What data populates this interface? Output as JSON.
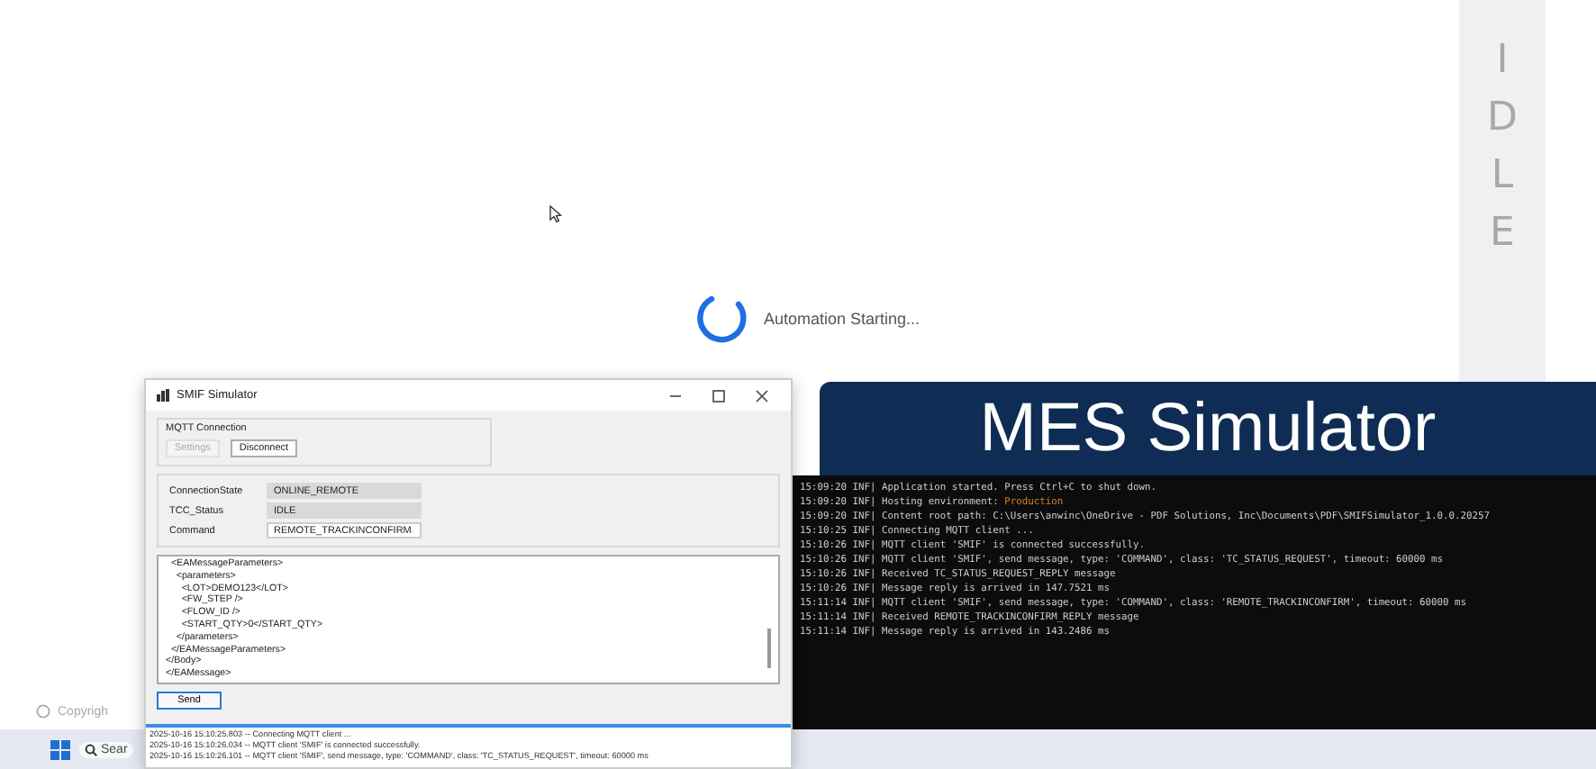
{
  "status_strip": {
    "text": "IDLE"
  },
  "loader": {
    "text": "Automation Starting..."
  },
  "footer": {
    "text": "Copyrigh"
  },
  "taskbar": {
    "search": "Sear"
  },
  "banner": {
    "title": "MES Simulator"
  },
  "console": {
    "lines": [
      {
        "time": "15:09:20",
        "level": "INF|",
        "message": "Application started. Press Ctrl+C to shut down."
      },
      {
        "time": "15:09:20",
        "level": "INF|",
        "message": "Hosting environment: ",
        "value": "Production"
      },
      {
        "time": "15:09:20",
        "level": "INF|",
        "message": "Content root path: C:\\Users\\anwinc\\OneDrive - PDF Solutions, Inc\\Documents\\PDF\\SMIFSimulator_1.0.0.20257"
      },
      {
        "time": "15:10:25",
        "level": "INF|",
        "message": "Connecting MQTT client ..."
      },
      {
        "time": "15:10:26",
        "level": "INF|",
        "message": "MQTT client 'SMIF' is connected successfully."
      },
      {
        "time": "15:10:26",
        "level": "INF|",
        "message": "MQTT client 'SMIF', send message, type: 'COMMAND', class: 'TC_STATUS_REQUEST', timeout: 60000 ms"
      },
      {
        "time": "15:10:26",
        "level": "INF|",
        "message": "Received TC_STATUS_REQUEST_REPLY message"
      },
      {
        "time": "15:10:26",
        "level": "INF|",
        "message": "Message reply is arrived in 147.7521 ms"
      },
      {
        "time": "15:11:14",
        "level": "INF|",
        "message": "MQTT client 'SMIF', send message, type: 'COMMAND', class: 'REMOTE_TRACKINCONFIRM', timeout: 60000 ms"
      },
      {
        "time": "15:11:14",
        "level": "INF|",
        "message": "Received REMOTE_TRACKINCONFIRM_REPLY message"
      },
      {
        "time": "15:11:14",
        "level": "INF|",
        "message": "Message reply is arrived in 143.2486 ms"
      }
    ]
  },
  "smif_window": {
    "title": "SMIF Simulator",
    "group_title": "MQTT Connection",
    "buttons": [
      {
        "label": "Settings",
        "disabled": true
      },
      {
        "label": "Disconnect",
        "disabled": false
      }
    ],
    "fields": [
      {
        "kind": "readonly",
        "label": "ConnectionState",
        "value": "ONLINE_REMOTE"
      },
      {
        "kind": "readonly",
        "label": "TCC_Status",
        "value": "IDLE"
      },
      {
        "kind": "dropdown",
        "label": "Command",
        "value": "REMOTE_TRACKINCONFIRM"
      }
    ],
    "xml_lines": [
      "  <EAMessageParameters>",
      "    <parameters>",
      "      <LOT>DEMO123</LOT>",
      "      <FW_STEP />",
      "      <FLOW_ID />",
      "      <START_QTY>0</START_QTY>",
      "    </parameters>",
      "  </EAMessageParameters>",
      "</Body>",
      "</EAMessage>"
    ],
    "send": "Send",
    "log": [
      "2025-10-16 15:10:25.803 -- Connecting MQTT client ...",
      "2025-10-16 15:10:26.034 -- MQTT client 'SMIF' is connected successfully.",
      "2025-10-16 15:10:26.101 -- MQTT client 'SMIF', send message, type: 'COMMAND', class: 'TC_STATUS_REQUEST', timeout: 60000 ms"
    ]
  }
}
